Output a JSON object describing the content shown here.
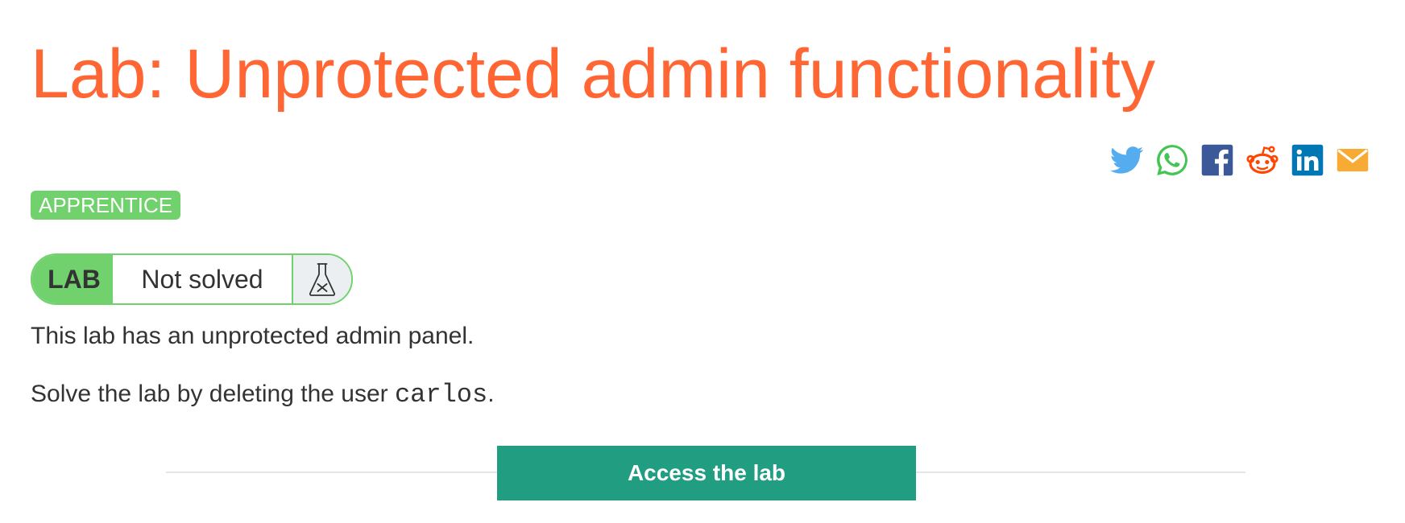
{
  "page": {
    "title": "Lab: Unprotected admin functionality"
  },
  "share": {
    "items": [
      {
        "icon": "twitter-icon",
        "color": "#55acee"
      },
      {
        "icon": "whatsapp-icon",
        "color": "#43c553"
      },
      {
        "icon": "facebook-icon",
        "color": "#3b5998"
      },
      {
        "icon": "reddit-icon",
        "color": "#ff4500"
      },
      {
        "icon": "linkedin-icon",
        "color": "#0077b5"
      },
      {
        "icon": "email-icon",
        "color": "#f8ab34"
      }
    ]
  },
  "level": {
    "label": "APPRENTICE",
    "color": "#70d16d"
  },
  "lab_status": {
    "tag": "LAB",
    "status": "Not solved",
    "icon": "flask-icon"
  },
  "description": {
    "line1": "This lab has an unprotected admin panel.",
    "line2_prefix": "Solve the lab by deleting the user ",
    "line2_code": "carlos",
    "line2_suffix": "."
  },
  "actions": {
    "access_label": "Access the lab",
    "access_color": "#219d82"
  },
  "colors": {
    "title": "#ff6633",
    "text": "#333333"
  }
}
